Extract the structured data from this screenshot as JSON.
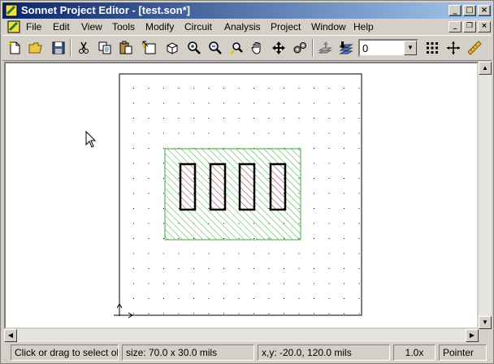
{
  "window": {
    "title": "Sonnet Project Editor - [test.son*]",
    "caption_buttons": [
      "_",
      "□",
      "×"
    ]
  },
  "menu": {
    "items": [
      "File",
      "Edit",
      "View",
      "Tools",
      "Modify",
      "Circuit",
      "Analysis",
      "Project",
      "Window",
      "Help"
    ],
    "mdi_buttons": [
      "_",
      "❐",
      "×"
    ]
  },
  "toolbar": {
    "buttons": [
      {
        "name": "new-icon"
      },
      {
        "name": "open-folder-icon"
      },
      {
        "name": "save-icon"
      },
      {
        "name": "cut-icon"
      },
      {
        "name": "copy-icon"
      },
      {
        "name": "paste-icon"
      },
      {
        "name": "select-icon"
      },
      {
        "name": "3d-view-icon"
      },
      {
        "name": "zoom-in-icon"
      },
      {
        "name": "zoom-out-icon"
      },
      {
        "name": "zoom-rubber-band-icon"
      },
      {
        "name": "pan-hand-icon"
      },
      {
        "name": "move-arrows-icon"
      },
      {
        "name": "settings-gears-icon"
      },
      {
        "name": "level-up-icon"
      },
      {
        "name": "level-down-icon"
      },
      {
        "name": "grid-icon"
      },
      {
        "name": "reference-plane-icon"
      },
      {
        "name": "ruler-icon"
      }
    ],
    "level_value": "0"
  },
  "status": {
    "hint": "Click or drag to select objects",
    "size": "size: 70.0 x 30.0 mils",
    "coords": "x,y: -20.0, 120.0 mils",
    "zoom": "1.0x",
    "mode": "Pointer"
  },
  "colors": {
    "title_start": "#0a246a",
    "title_end": "#a6caf0",
    "chrome": "#d4d0c8",
    "hatch_green": "#3aa83a",
    "hatch_red": "#c0406a"
  }
}
